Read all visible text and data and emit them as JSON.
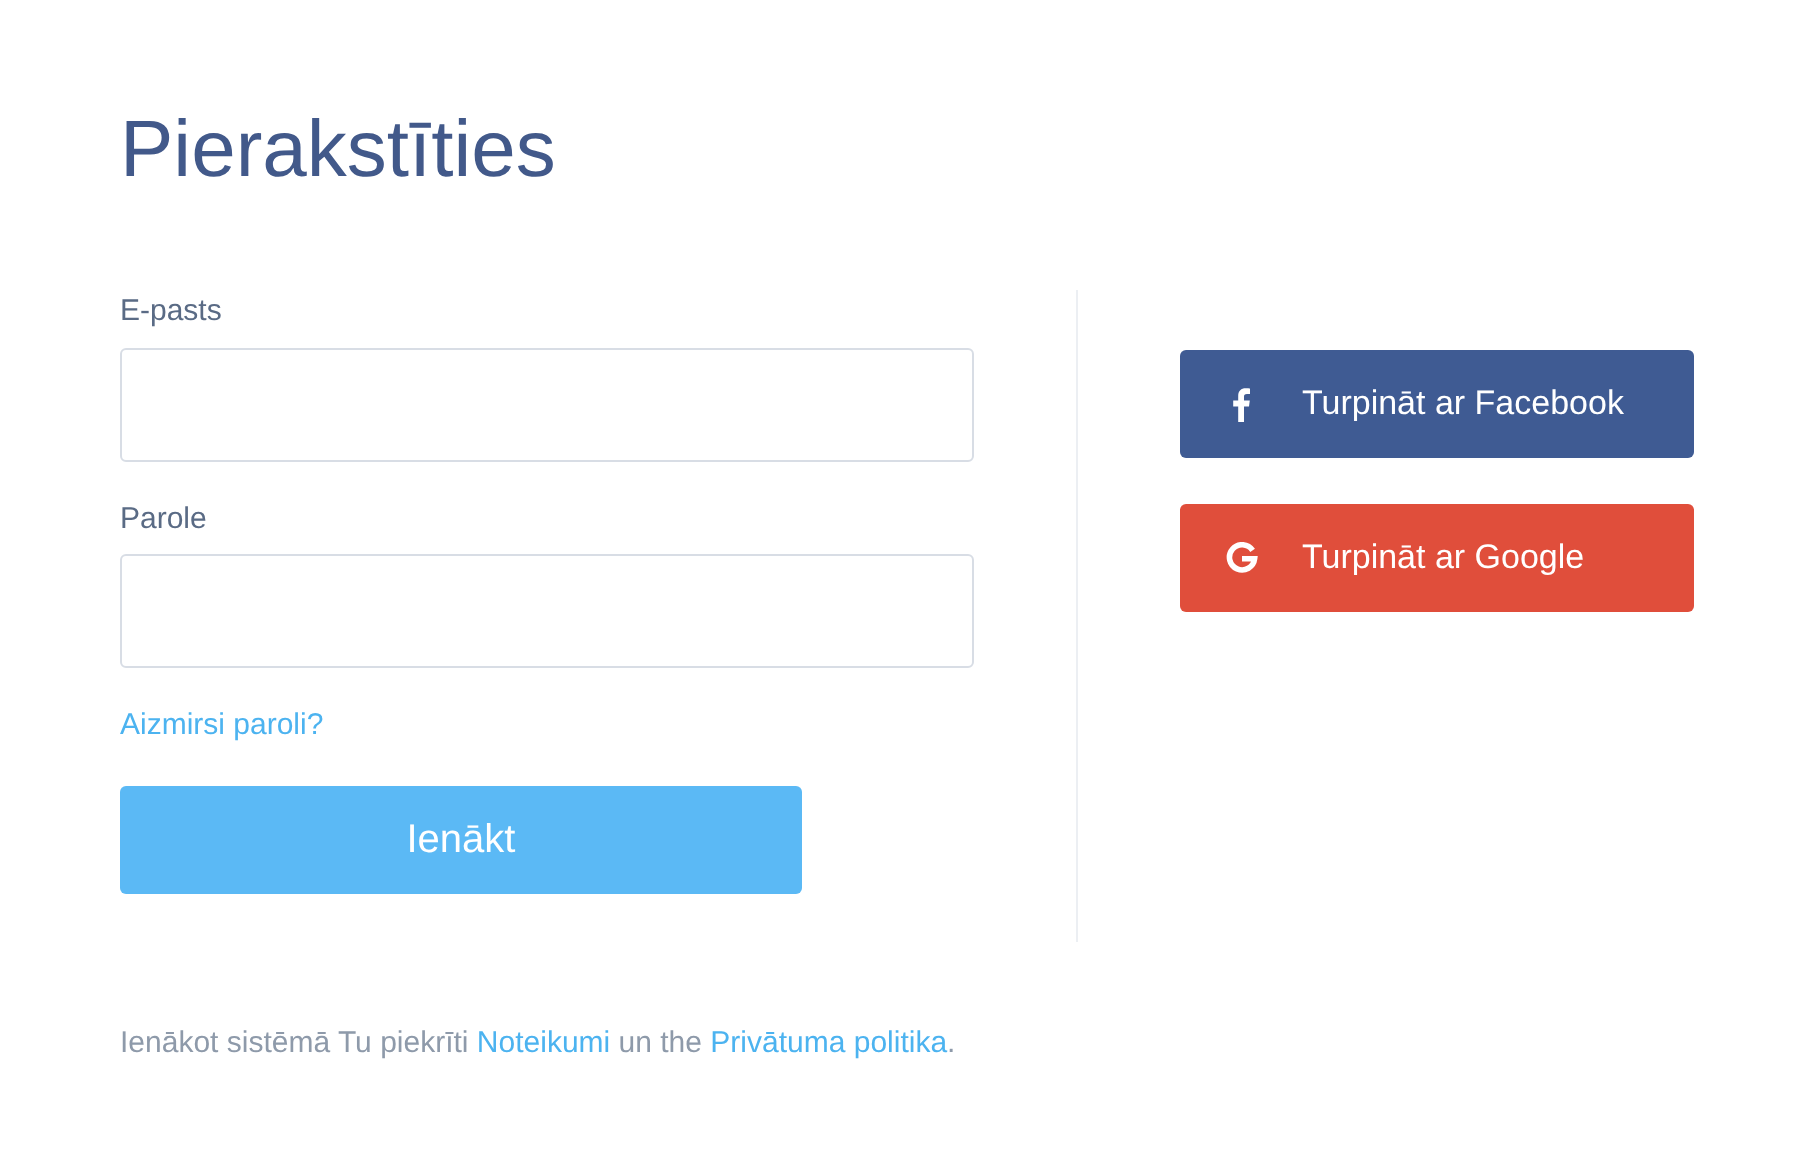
{
  "title": "Pierakstīties",
  "fields": [
    {
      "label": "E-pasts"
    },
    {
      "label": "Parole"
    }
  ],
  "forgot_link": "Aizmirsi paroli?",
  "login_button": "Ienākt",
  "social_buttons": [
    {
      "kind": "facebook",
      "label": "Turpināt ar Facebook"
    },
    {
      "kind": "google",
      "label": "Turpināt ar Google"
    }
  ],
  "footer": [
    {
      "kind": "text",
      "text": "Ienākot sistēmā Tu piekrīti "
    },
    {
      "kind": "link",
      "text": "Noteikumi"
    },
    {
      "kind": "text",
      "text": " un the "
    },
    {
      "kind": "link",
      "text": "Privātuma politika"
    },
    {
      "kind": "text",
      "text": "."
    }
  ]
}
